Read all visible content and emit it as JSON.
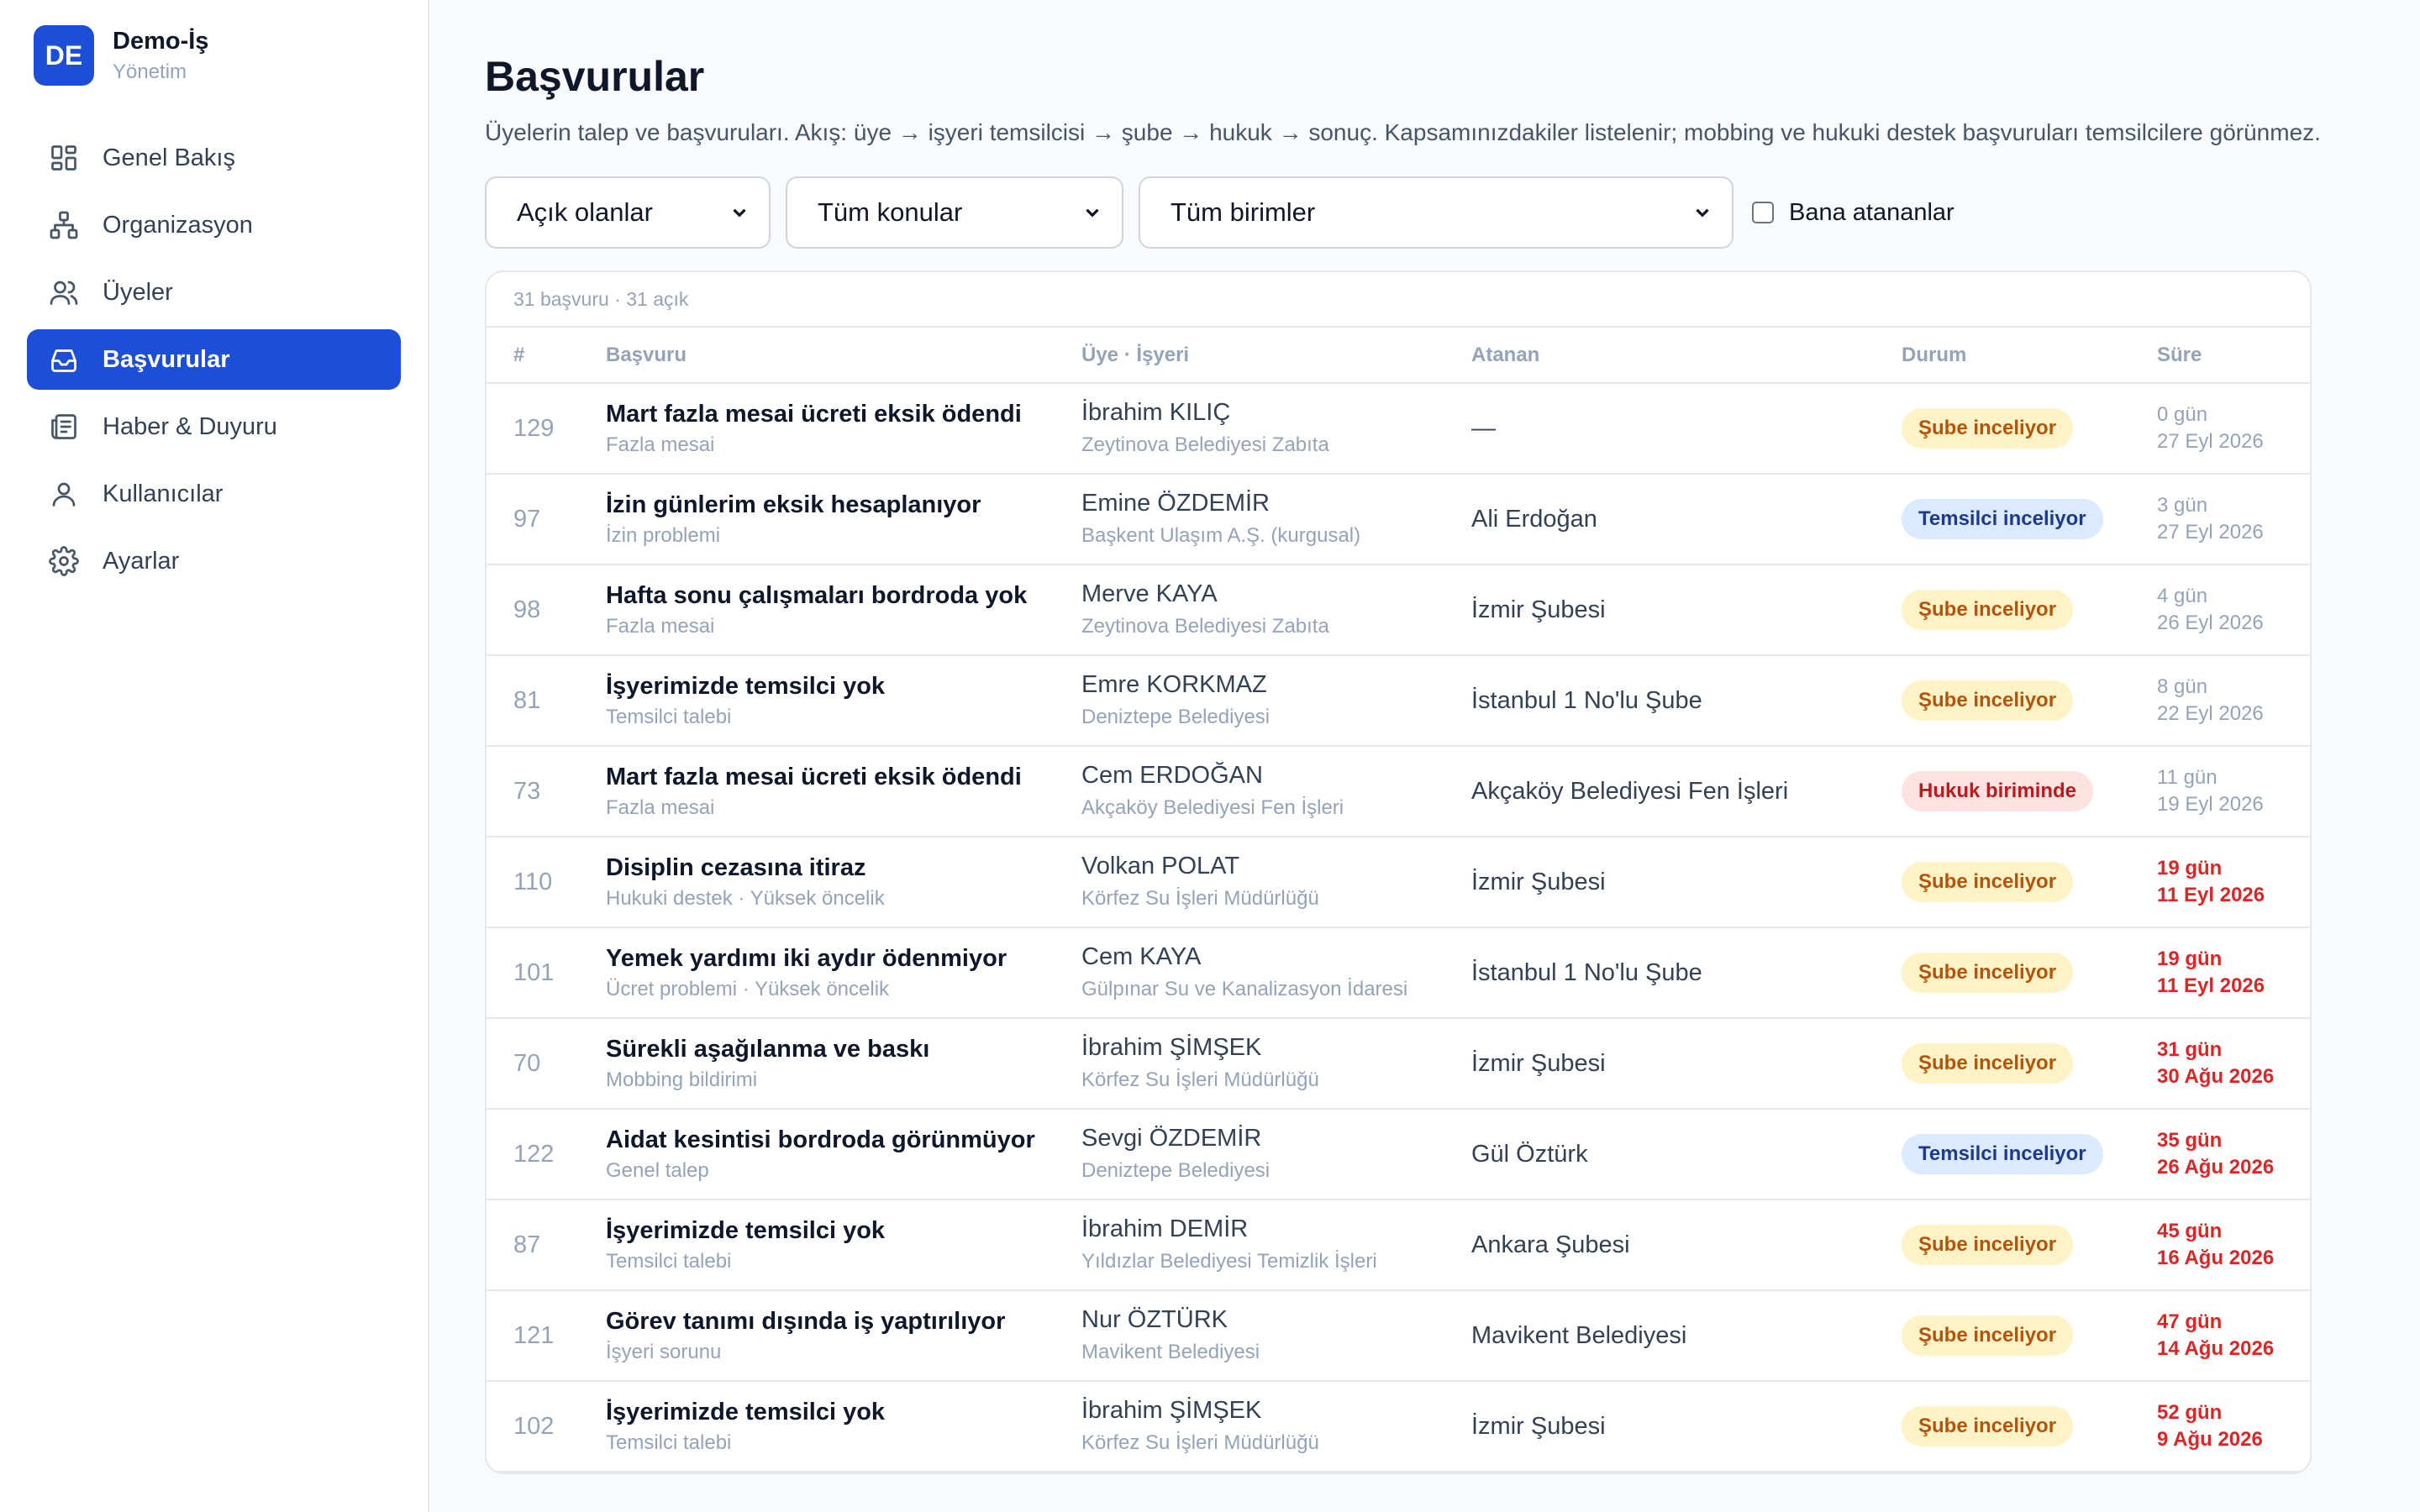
{
  "brand": {
    "initials": "DE",
    "name": "Demo-İş",
    "subtitle": "Yönetim"
  },
  "sidebar": {
    "items": [
      {
        "label": "Genel Bakış",
        "icon": "dashboard-icon",
        "active": false
      },
      {
        "label": "Organizasyon",
        "icon": "org-chart-icon",
        "active": false
      },
      {
        "label": "Üyeler",
        "icon": "users-icon",
        "active": false
      },
      {
        "label": "Başvurular",
        "icon": "inbox-icon",
        "active": true
      },
      {
        "label": "Haber & Duyuru",
        "icon": "newspaper-icon",
        "active": false
      },
      {
        "label": "Kullanıcılar",
        "icon": "user-icon",
        "active": false
      },
      {
        "label": "Ayarlar",
        "icon": "gear-icon",
        "active": false
      }
    ]
  },
  "page": {
    "title": "Başvurular",
    "description": "Üyelerin talep ve başvuruları. Akış: üye → işyeri temsilcisi → şube → hukuk → sonuç. Kapsamınızdakiler listelenir; mobbing ve hukuki destek başvuruları temsilcilere görünmez."
  },
  "filters": {
    "status": "Açık olanlar",
    "topic": "Tüm konular",
    "unit": "Tüm birimler",
    "assigned_to_me": "Bana atananlar"
  },
  "table": {
    "meta": "31 başvuru · 31 açık",
    "headers": {
      "num": "#",
      "title": "Başvuru",
      "member": "Üye · İşyeri",
      "assignee": "Atanan",
      "status": "Durum",
      "age": "Süre"
    },
    "rows": [
      {
        "id": "129",
        "title": "Mart fazla mesai ücreti eksik ödendi",
        "category": "Fazla mesai",
        "member": "İbrahim KILIÇ",
        "workplace": "Zeytinova Belediyesi Zabıta",
        "assignee": "—",
        "status": "Şube inceliyor",
        "status_tone": "amber",
        "days": "0 gün",
        "date": "27 Eyl 2026",
        "overdue": false
      },
      {
        "id": "97",
        "title": "İzin günlerim eksik hesaplanıyor",
        "category": "İzin problemi",
        "member": "Emine ÖZDEMİR",
        "workplace": "Başkent Ulaşım A.Ş. (kurgusal)",
        "assignee": "Ali Erdoğan",
        "status": "Temsilci inceliyor",
        "status_tone": "blue",
        "days": "3 gün",
        "date": "27 Eyl 2026",
        "overdue": false
      },
      {
        "id": "98",
        "title": "Hafta sonu çalışmaları bordroda yok",
        "category": "Fazla mesai",
        "member": "Merve KAYA",
        "workplace": "Zeytinova Belediyesi Zabıta",
        "assignee": "İzmir Şubesi",
        "status": "Şube inceliyor",
        "status_tone": "amber",
        "days": "4 gün",
        "date": "26 Eyl 2026",
        "overdue": false
      },
      {
        "id": "81",
        "title": "İşyerimizde temsilci yok",
        "category": "Temsilci talebi",
        "member": "Emre KORKMAZ",
        "workplace": "Deniztepe Belediyesi",
        "assignee": "İstanbul 1 No'lu Şube",
        "status": "Şube inceliyor",
        "status_tone": "amber",
        "days": "8 gün",
        "date": "22 Eyl 2026",
        "overdue": false
      },
      {
        "id": "73",
        "title": "Mart fazla mesai ücreti eksik ödendi",
        "category": "Fazla mesai",
        "member": "Cem ERDOĞAN",
        "workplace": "Akçaköy Belediyesi Fen İşleri",
        "assignee": "Akçaköy Belediyesi Fen İşleri",
        "status": "Hukuk biriminde",
        "status_tone": "red",
        "days": "11 gün",
        "date": "19 Eyl 2026",
        "overdue": false
      },
      {
        "id": "110",
        "title": "Disiplin cezasına itiraz",
        "category": "Hukuki destek · Yüksek öncelik",
        "member": "Volkan POLAT",
        "workplace": "Körfez Su İşleri Müdürlüğü",
        "assignee": "İzmir Şubesi",
        "status": "Şube inceliyor",
        "status_tone": "amber",
        "days": "19 gün",
        "date": "11 Eyl 2026",
        "overdue": true
      },
      {
        "id": "101",
        "title": "Yemek yardımı iki aydır ödenmiyor",
        "category": "Ücret problemi · Yüksek öncelik",
        "member": "Cem KAYA",
        "workplace": "Gülpınar Su ve Kanalizasyon İdaresi",
        "assignee": "İstanbul 1 No'lu Şube",
        "status": "Şube inceliyor",
        "status_tone": "amber",
        "days": "19 gün",
        "date": "11 Eyl 2026",
        "overdue": true
      },
      {
        "id": "70",
        "title": "Sürekli aşağılanma ve baskı",
        "category": "Mobbing bildirimi",
        "member": "İbrahim ŞİMŞEK",
        "workplace": "Körfez Su İşleri Müdürlüğü",
        "assignee": "İzmir Şubesi",
        "status": "Şube inceliyor",
        "status_tone": "amber",
        "days": "31 gün",
        "date": "30 Ağu 2026",
        "overdue": true
      },
      {
        "id": "122",
        "title": "Aidat kesintisi bordroda görünmüyor",
        "category": "Genel talep",
        "member": "Sevgi ÖZDEMİR",
        "workplace": "Deniztepe Belediyesi",
        "assignee": "Gül Öztürk",
        "status": "Temsilci inceliyor",
        "status_tone": "blue",
        "days": "35 gün",
        "date": "26 Ağu 2026",
        "overdue": true
      },
      {
        "id": "87",
        "title": "İşyerimizde temsilci yok",
        "category": "Temsilci talebi",
        "member": "İbrahim DEMİR",
        "workplace": "Yıldızlar Belediyesi Temizlik İşleri",
        "assignee": "Ankara Şubesi",
        "status": "Şube inceliyor",
        "status_tone": "amber",
        "days": "45 gün",
        "date": "16 Ağu 2026",
        "overdue": true
      },
      {
        "id": "121",
        "title": "Görev tanımı dışında iş yaptırılıyor",
        "category": "İşyeri sorunu",
        "member": "Nur ÖZTÜRK",
        "workplace": "Mavikent Belediyesi",
        "assignee": "Mavikent Belediyesi",
        "status": "Şube inceliyor",
        "status_tone": "amber",
        "days": "47 gün",
        "date": "14 Ağu 2026",
        "overdue": true
      },
      {
        "id": "102",
        "title": "İşyerimizde temsilci yok",
        "category": "Temsilci talebi",
        "member": "İbrahim ŞİMŞEK",
        "workplace": "Körfez Su İşleri Müdürlüğü",
        "assignee": "İzmir Şubesi",
        "status": "Şube inceliyor",
        "status_tone": "amber",
        "days": "52 gün",
        "date": "9 Ağu 2026",
        "overdue": true
      }
    ]
  }
}
